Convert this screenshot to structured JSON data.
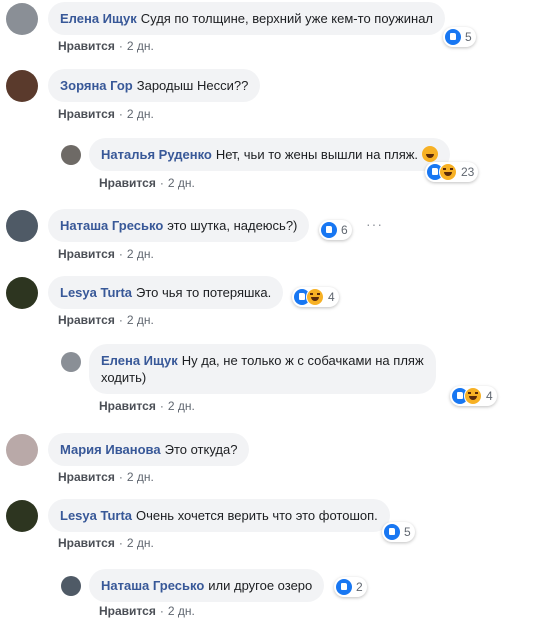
{
  "comments": [
    {
      "author": "Елена Ищук",
      "text": "Судя по толщине, верхний уже кем-то поужинал",
      "like": "Нравится",
      "time": "2 дн.",
      "reactions": "5",
      "avatar_color": "#8a8f96"
    },
    {
      "author": "Зоряна Гор",
      "text": "Зародыш Несси??",
      "like": "Нравится",
      "time": "2 дн.",
      "avatar_color": "#5a3a2c"
    },
    {
      "author": "Наталья Руденко",
      "text": "Нет, чьи то жены вышли на пляж.",
      "like": "Нравится",
      "time": "2 дн.",
      "reactions": "23",
      "avatar_color": "#6e6a66"
    },
    {
      "author": "Наташа Гресько",
      "text": "это шутка, надеюсь?)",
      "like": "Нравится",
      "time": "2 дн.",
      "reactions": "6",
      "more": "···",
      "avatar_color": "#4f5a66"
    },
    {
      "author": "Lesya Turta",
      "text": "Это чья то потеряшка.",
      "like": "Нравится",
      "time": "2 дн.",
      "reactions": "4",
      "avatar_color": "#2d3520"
    },
    {
      "author": "Елена Ищук",
      "text_line1": "Ну да, не только ж с собачками на пляж",
      "text_line2": "ходить)",
      "like": "Нравится",
      "time": "2 дн.",
      "reactions": "4",
      "avatar_color": "#8a8f96"
    },
    {
      "author": "Мария Иванова",
      "text": "Это откуда?",
      "like": "Нравится",
      "time": "2 дн.",
      "avatar_color": "#b9a9a8"
    },
    {
      "author": "Lesya Turta",
      "text": "Очень хочется верить что это фотошоп.",
      "like": "Нравится",
      "time": "2 дн.",
      "reactions": "5",
      "avatar_color": "#2d3520"
    },
    {
      "author": "Наташа Гресько",
      "text": "или другое озеро",
      "like": "Нравится",
      "time": "2 дн.",
      "reactions": "2",
      "avatar_color": "#4f5a66"
    }
  ],
  "separator": "·"
}
